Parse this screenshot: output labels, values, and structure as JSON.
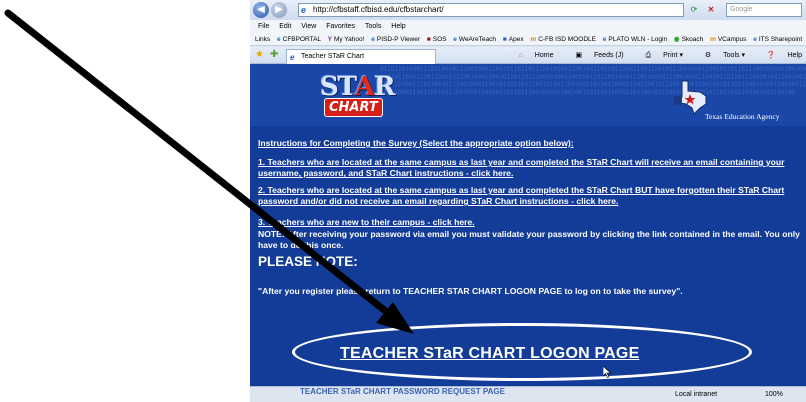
{
  "browser": {
    "address": "http://cfbstaff.cfbisd.edu/cfbstarchart/",
    "search_placeholder": "Google",
    "back_glyph": "◀",
    "forward_glyph": "▶",
    "refresh_glyph": "⟳",
    "stop_glyph": "✕",
    "menu": [
      "File",
      "Edit",
      "View",
      "Favorites",
      "Tools",
      "Help"
    ],
    "links_label": "Links",
    "links": [
      "CFBPORTAL",
      "My Yahoo!",
      "PISD-P Viewer",
      "SOS",
      "WeAreTeach",
      "Apex",
      "C-FB ISD MOODLE",
      "PLATO WLN - Login",
      "Skoach",
      "VCampus",
      "ITS Sharepoint"
    ],
    "tab_title": "Teacher STaR Chart",
    "commands": {
      "home": "Home",
      "feeds": "Feeds (J)",
      "print": "Print",
      "tools": "Tools",
      "help": "Help"
    },
    "status": {
      "zone": "Local intranet",
      "zoom": "100%"
    }
  },
  "page": {
    "logo": {
      "star_text": "ST",
      "star_accent": "A",
      "star_end": "R",
      "chart_text": "CHART"
    },
    "agency": "Texas Education Agency",
    "binary_pattern": "0110110100011101100101110010001100101101101110010100110010011011011000111011001011100100011001011011011100101001100100110110110001110110010111001000110010110110111001010011001001101101100011101100101110010001100101101101110010100110010011011011000111011001011100100011001011011011100101001100100110110110001110110010111001000110010110110111001010011001001101101100011101100101110010001100101101101110010100110010011011011000111011001011100100011001011011011100101001100100",
    "instructions_heading": "Instructions for Completing the Survey (Select the appropriate option below):",
    "item1": "1.   Teachers who are located at the same campus as last year and completed the STaR Chart will receive an email containing your username, password, and STaR Chart instructions - click here.",
    "item2": "2.   Teachers who are located at the same campus as last year and completed the STaR Chart BUT have forgotten their STaR Chart password and/or did not receive an email regarding STaR Chart instructions - click here.",
    "item3": "3.   Teachers who are new to their campus - click here.",
    "note": "NOTE: After receiving your password via email you must validate your password by clicking the link contained in the email.  You only have to do this once.",
    "please_note": "PLEASE NOTE:",
    "quote": "\"After you register please return to TEACHER STAR CHART LOGON PAGE to log on to take the survey\".",
    "logon_link": "TEACHER STaR CHART LOGON PAGE",
    "faded_line": "TEACHER STaR CHART PASSWORD REQUEST PAGE"
  },
  "colors": {
    "page_bg": "#123c98",
    "header_bg": "#1b47a8",
    "text": "#ffffff",
    "annotation": "#000000",
    "logo_red": "#d51f18"
  }
}
